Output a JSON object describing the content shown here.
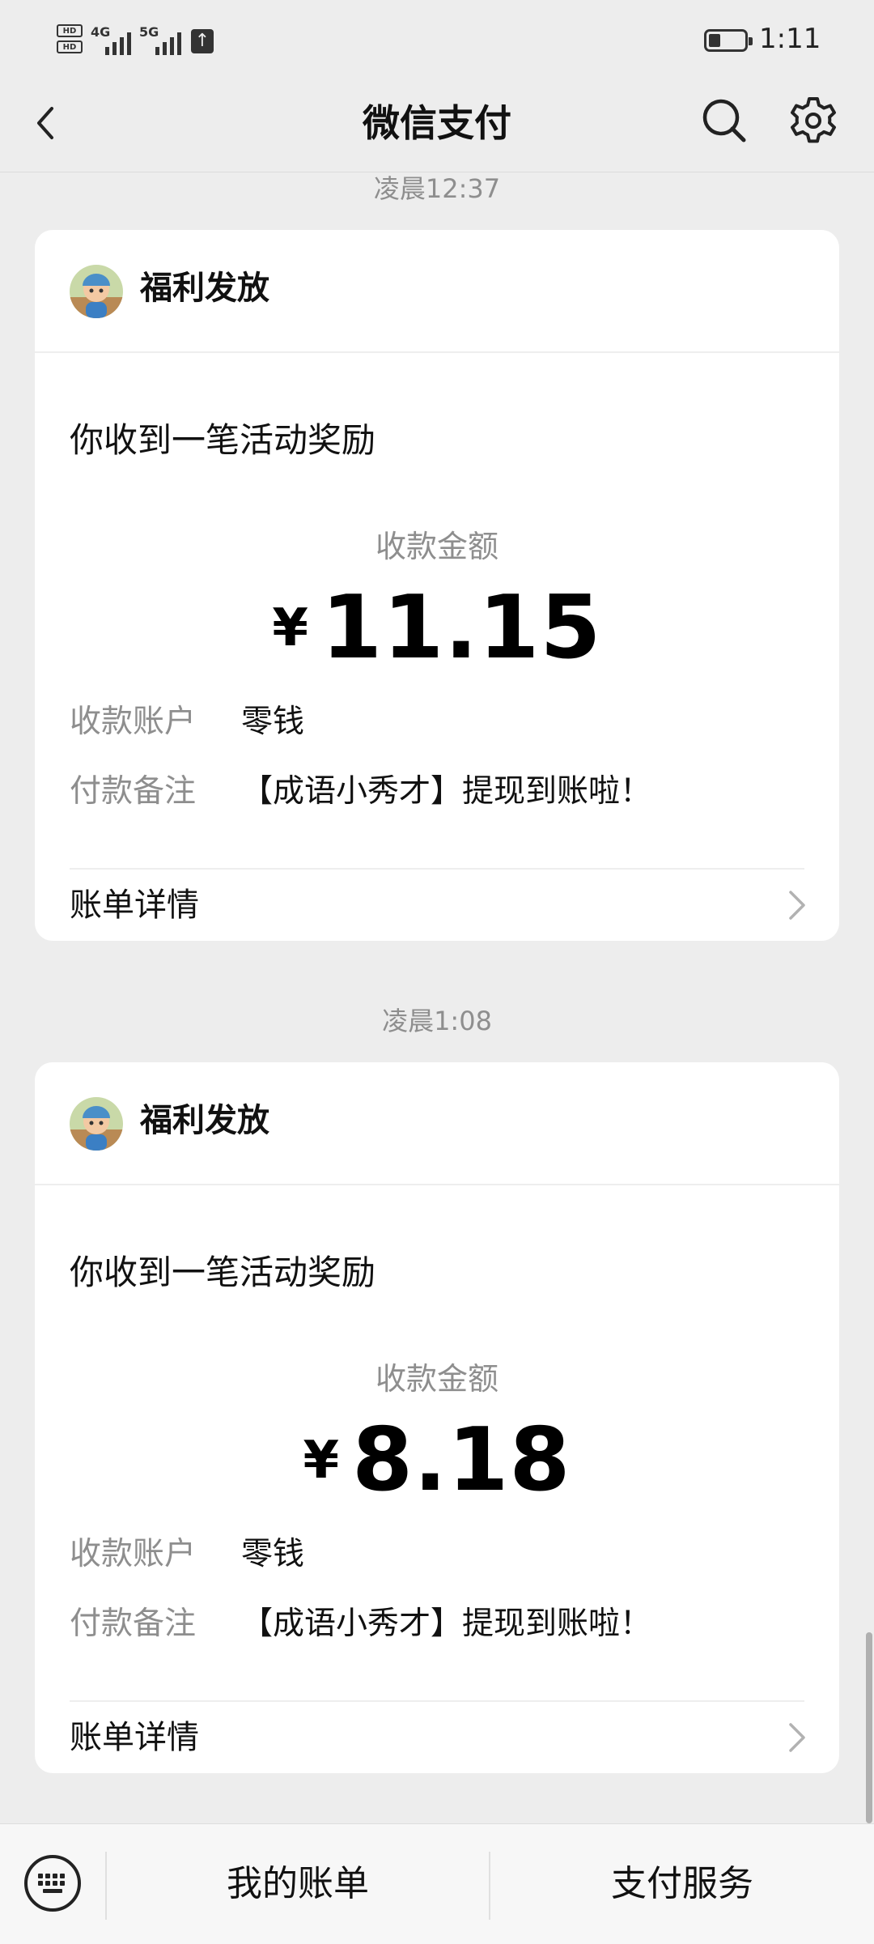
{
  "status_bar": {
    "hd1": "HD",
    "hd2": "HD",
    "net1": "4G",
    "net2": "5G",
    "time": "1:11"
  },
  "header": {
    "title": "微信支付"
  },
  "messages": [
    {
      "time": "凌晨12:37",
      "sender": "福利发放",
      "headline": "你收到一笔活动奖励",
      "amount_label": "收款金额",
      "currency": "¥",
      "amount": "11.15",
      "account_key": "收款账户",
      "account_value": "零钱",
      "remark_key": "付款备注",
      "remark_value": "【成语小秀才】提现到账啦！",
      "detail_label": "账单详情"
    },
    {
      "time": "凌晨1:08",
      "sender": "福利发放",
      "headline": "你收到一笔活动奖励",
      "amount_label": "收款金额",
      "currency": "¥",
      "amount": "8.18",
      "account_key": "收款账户",
      "account_value": "零钱",
      "remark_key": "付款备注",
      "remark_value": "【成语小秀才】提现到账啦！",
      "detail_label": "账单详情"
    }
  ],
  "bottom_bar": {
    "my_bills": "我的账单",
    "pay_services": "支付服务"
  }
}
